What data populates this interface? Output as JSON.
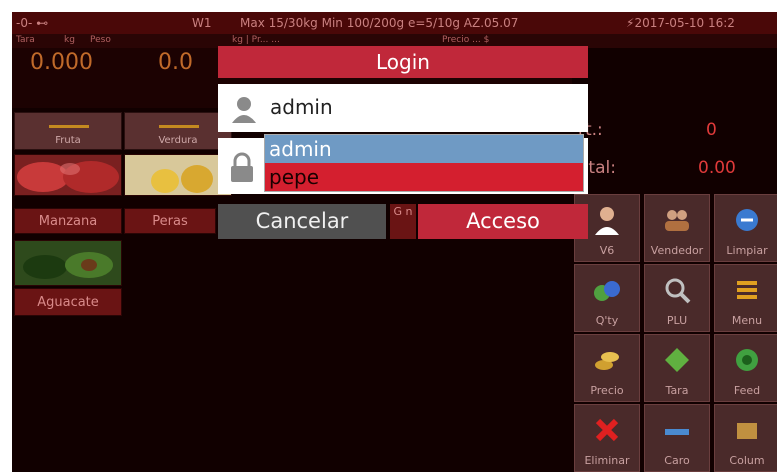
{
  "status_bar": {
    "left_icons": "-0- ⊷",
    "w1": "W1",
    "spec": "Max 15/30kg Min 100/200g e=5/10g  AZ.05.07",
    "datetime": "2017-05-10 16:2"
  },
  "sub_bar": {
    "tara": "Tara",
    "kg": "kg",
    "peso": "Peso",
    "mid": "kg | Pr...  ...",
    "right": "Precio   ...   $"
  },
  "readouts": {
    "tara_value": "0.000",
    "peso_value": "0.0"
  },
  "categories": [
    {
      "label": "Fruta"
    },
    {
      "label": "Verdura"
    }
  ],
  "products": [
    {
      "label": "Manzana"
    },
    {
      "label": "Peras"
    },
    {
      "label": "Aguacate"
    }
  ],
  "totals": {
    "cart_label": "rt.:",
    "cart_value": "0",
    "total_label": "otal:",
    "total_value": "0.00"
  },
  "buttons": [
    {
      "label": "V6",
      "icon": "user-icon"
    },
    {
      "label": "Vendedor",
      "icon": "sellers-icon"
    },
    {
      "label": "Limpiar",
      "icon": "clean-icon"
    },
    {
      "label": "Q'ty",
      "icon": "quantity-icon"
    },
    {
      "label": "PLU",
      "icon": "magnifier-icon"
    },
    {
      "label": "Menu",
      "icon": "menu-list-icon"
    },
    {
      "label": "Precio",
      "icon": "coins-icon"
    },
    {
      "label": "Tara",
      "icon": "tare-icon"
    },
    {
      "label": "Feed",
      "icon": "feed-icon"
    },
    {
      "label": "Eliminar",
      "icon": "delete-x-icon"
    },
    {
      "label": "Caro",
      "icon": "scale-icon"
    },
    {
      "label": "Colum",
      "icon": "box-icon"
    }
  ],
  "login": {
    "title": "Login",
    "username_value": "admin",
    "dropdown_options": [
      "admin",
      "pepe"
    ],
    "mid_sliver": "G n",
    "cancel_label": "Cancelar",
    "access_label": "Acceso"
  },
  "colors": {
    "accent_red": "#c0283a",
    "highlight_blue": "#6f9ac4",
    "background": "#110000"
  }
}
